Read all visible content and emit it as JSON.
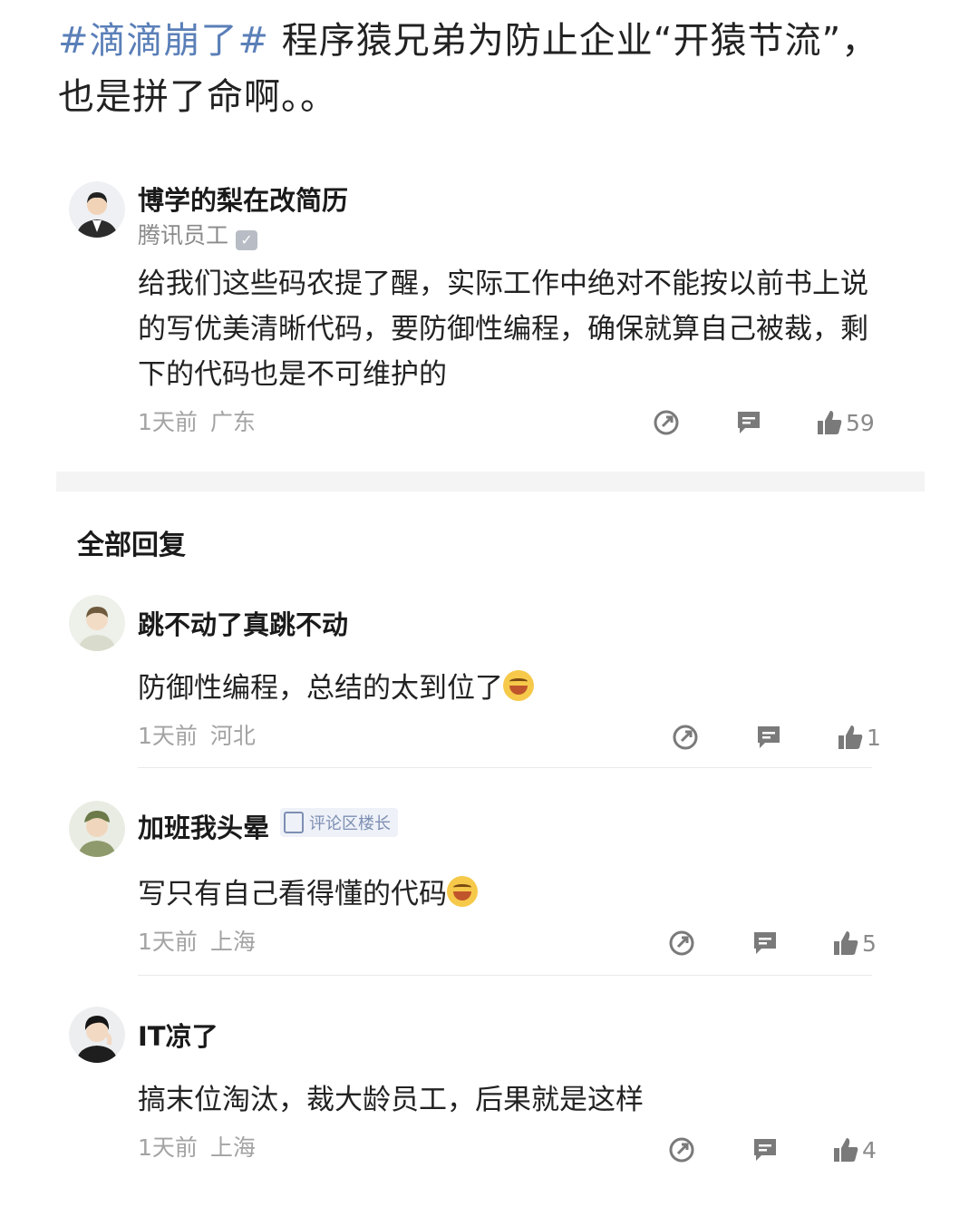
{
  "post": {
    "hashtag": "#滴滴崩了#",
    "text_line1": " 程序猿兄弟为防止企业“开猿节流”，",
    "text_line2": "也是拼了命啊。。"
  },
  "top_comment": {
    "username": "博学的梨在改简历",
    "subtitle": "腾讯员工",
    "text": "给我们这些码农提了醒，实际工作中绝对不能按以前书上说的写优美清晰代码，要防御性编程，确保就算自己被裁，剩下的代码也是不可维护的",
    "time": "1天前",
    "location": "广东",
    "likes": "59"
  },
  "section_title": "全部回复",
  "replies": [
    {
      "username": "跳不动了真跳不动",
      "text": "防御性编程，总结的太到位了",
      "emoji": "grinning-sweat-emoji",
      "time": "1天前",
      "location": "河北",
      "likes": "1"
    },
    {
      "username": "加班我头晕",
      "badge": "评论区楼长",
      "text": "写只有自己看得懂的代码",
      "emoji": "smiling-emoji",
      "time": "1天前",
      "location": "上海",
      "likes": "5"
    },
    {
      "username": "IT凉了",
      "text": "搞末位淘汰，裁大龄员工，后果就是这样",
      "time": "1天前",
      "location": "上海",
      "likes": "4"
    }
  ],
  "icons": {
    "share": "share-icon",
    "reply": "comment-icon",
    "like": "thumbs-up-icon"
  },
  "colors": {
    "hashtag": "#5a7fb8",
    "meta": "#a3a3a3",
    "icon": "#7a7a7a"
  }
}
